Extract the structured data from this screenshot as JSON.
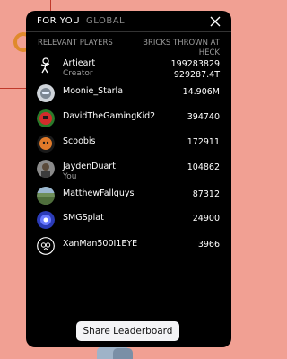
{
  "tabs": [
    {
      "label": "FOR YOU",
      "active": true
    },
    {
      "label": "GLOBAL",
      "active": false
    }
  ],
  "headers": {
    "players": "RELEVANT PLAYERS",
    "score": "BRICKS THROWN AT HECK"
  },
  "players": [
    {
      "name": "Artieart",
      "subtitle": "Creator",
      "score": "199283829",
      "score_extra": "929287.4T",
      "avatar_icon": "stick-figure-icon"
    },
    {
      "name": "Moonie_Starla",
      "subtitle": "",
      "score": "14.906M",
      "score_extra": "",
      "avatar_icon": "robot-avatar-icon"
    },
    {
      "name": "DavidTheGamingKid2",
      "subtitle": "",
      "score": "394740",
      "score_extra": "",
      "avatar_icon": "red-character-avatar-icon"
    },
    {
      "name": "Scoobis",
      "subtitle": "",
      "score": "172911",
      "score_extra": "",
      "avatar_icon": "orange-avatar-icon"
    },
    {
      "name": "JaydenDuart",
      "subtitle": "You",
      "score": "104862",
      "score_extra": "",
      "avatar_icon": "player-avatar-icon"
    },
    {
      "name": "MatthewFallguys",
      "subtitle": "",
      "score": "87312",
      "score_extra": "",
      "avatar_icon": "landscape-avatar-icon"
    },
    {
      "name": "SMGSplat",
      "subtitle": "",
      "score": "24900",
      "score_extra": "",
      "avatar_icon": "blue-avatar-icon"
    },
    {
      "name": "XanMan500I1EYE",
      "subtitle": "",
      "score": "3966",
      "score_extra": "",
      "avatar_icon": "owl-emblem-icon"
    }
  ],
  "share_button": "Share Leaderboard",
  "colors": {
    "panel": "#000000",
    "background": "#f1a093",
    "button": "#f4f4f6"
  }
}
